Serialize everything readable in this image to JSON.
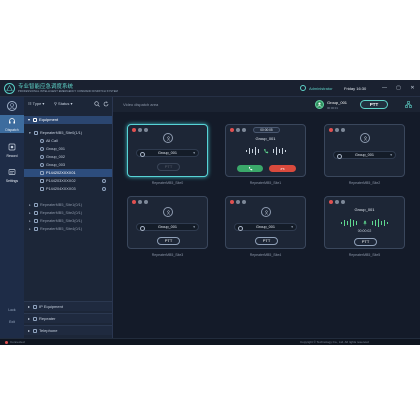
{
  "app": {
    "title": "专业智能应急调度系统",
    "subtitle": "PROFESSIONAL INTELLIGENT EMERGENCY COMMAND DISPATCH SYSTEM",
    "user": "Administrator",
    "datetime": "Friday 16:30",
    "controls": {
      "minimize": "—",
      "maximize": "▢",
      "close": "✕"
    }
  },
  "nav": {
    "avatar_icon": "user-avatar-icon",
    "items": [
      {
        "label": "Dispatch",
        "icon": "headset-icon",
        "active": true
      },
      {
        "label": "Record",
        "icon": "record-icon",
        "active": false
      },
      {
        "label": "Settings",
        "icon": "settings-icon",
        "active": false
      }
    ],
    "bottom": [
      {
        "label": "Lock"
      },
      {
        "label": "Exit"
      }
    ]
  },
  "tree": {
    "filters": {
      "type": "Type",
      "status": "Status"
    },
    "sections": {
      "equipment": "Equipment",
      "ip_equipment": "IP Equipment",
      "repeater": "Repeater",
      "telephone": "Telephone"
    },
    "site0": {
      "label": "RepeaterMB5_Site0(1/1)",
      "children": [
        "All Call",
        "Group_001",
        "Group_002",
        "Group_003",
        "P144202XXXX01",
        "P144203XXXX02",
        "P144204XXXX03"
      ],
      "selected_child": 4
    },
    "sites": [
      "RepeaterMB5_Site1(0/1)",
      "RepeaterMB5_Site2(0/1)",
      "RepeaterMB5_Site3(0/1)",
      "RepeaterMB5_Site4(0/1)"
    ]
  },
  "main": {
    "area_title": "Video dispatch area",
    "active_group": {
      "name": "Group_001",
      "status": "00:00:01"
    },
    "ptt": "PTT",
    "cards": [
      {
        "label": "RepeaterMB5_Site0",
        "group": "Group_001",
        "ptt": "PTT",
        "selected": true
      },
      {
        "label": "RepeaterMB5_Site1",
        "group": "Group_001",
        "timer": "00:00:05"
      },
      {
        "label": "RepeaterMB5_Site2",
        "group": "Group_001"
      },
      {
        "label": "RepeaterMB5_Site3",
        "group": "Group_001",
        "ptt": "PTT"
      },
      {
        "label": "RepeaterMB5_Site4",
        "group": "Group_001",
        "ptt": "PTT"
      },
      {
        "label": "RepeaterMB5_Site5",
        "group": "Group_001",
        "timer": "00:00:02",
        "ptt": "PTT"
      }
    ]
  },
  "status_bar": {
    "left": "Connected",
    "right": "Copyright © Technology Co., Ltd. All rights reserved"
  },
  "colors": {
    "accent": "#5fd3c8",
    "nav_active": "#3d6c9e",
    "accept": "#3aa86a",
    "reject": "#d94a3d",
    "alert": "#e05050"
  }
}
